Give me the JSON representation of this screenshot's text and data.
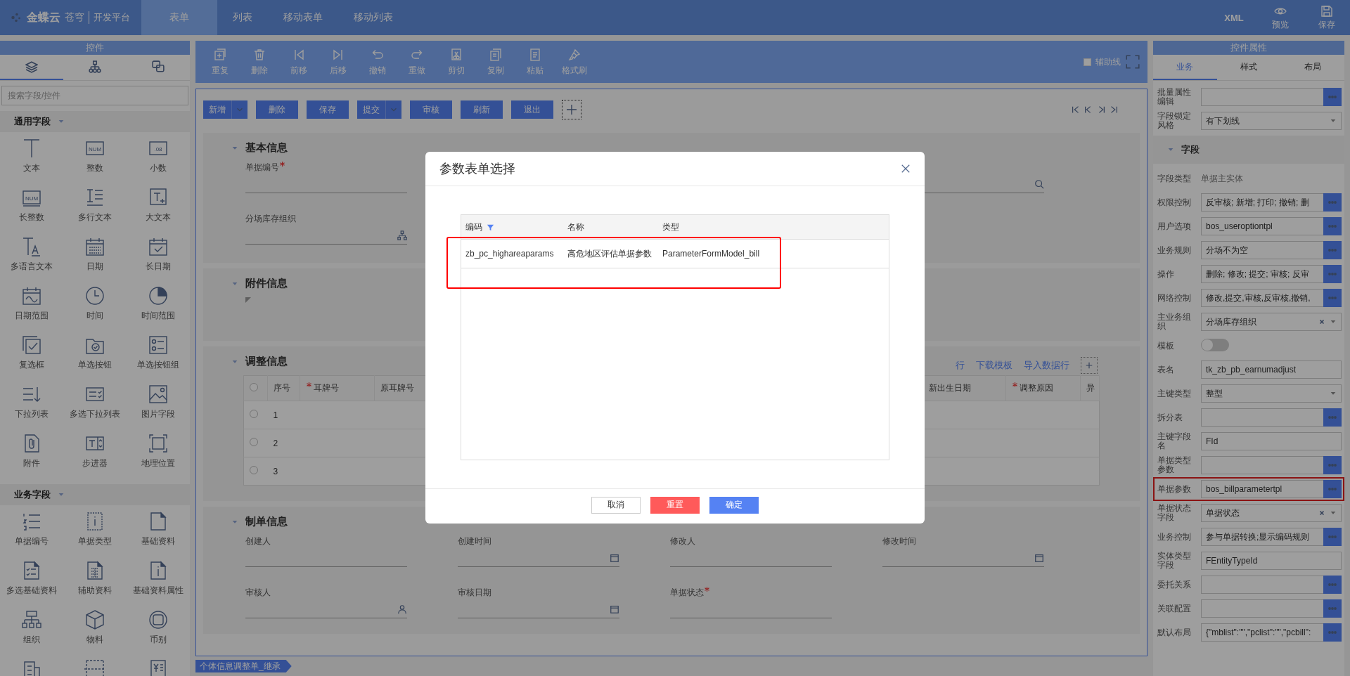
{
  "top_bar": {
    "logo": "金蝶云",
    "logo_sub": "苍穹",
    "platform": "开发平台",
    "tabs": [
      {
        "label": "表单",
        "selected": true
      },
      {
        "label": "列表",
        "selected": false
      },
      {
        "label": "移动表单",
        "selected": false
      },
      {
        "label": "移动列表",
        "selected": false
      }
    ],
    "actions": [
      {
        "label": "XML",
        "kind": "text"
      },
      {
        "label": "预览",
        "kind": "preview"
      },
      {
        "label": "保存",
        "kind": "save"
      }
    ]
  },
  "controls_panel": {
    "title": "控件",
    "tabs": [
      {
        "selected": true
      },
      {
        "selected": false
      },
      {
        "selected": false
      }
    ],
    "search": {
      "placeholder": "搜索字段/控件"
    },
    "groups": [
      {
        "title": "通用字段",
        "expanded": true,
        "icon_texts": [
          "NUM",
          ".08",
          "NUM"
        ],
        "items": [
          {
            "label": "文本"
          },
          {
            "label": "整数"
          },
          {
            "label": "小数"
          },
          {
            "label": "长整数"
          },
          {
            "label": "多行文本"
          },
          {
            "label": "大文本"
          },
          {
            "label": "多语言文本"
          },
          {
            "label": "日期"
          },
          {
            "label": "长日期"
          },
          {
            "label": "日期范围"
          },
          {
            "label": "时间"
          },
          {
            "label": "时间范围"
          },
          {
            "label": "复选框"
          },
          {
            "label": "单选按钮"
          },
          {
            "label": "单选按钮组"
          },
          {
            "label": "下拉列表"
          },
          {
            "label": "多选下拉列表"
          },
          {
            "label": "图片字段"
          },
          {
            "label": "附件"
          },
          {
            "label": "步进器"
          },
          {
            "label": "地理位置"
          }
        ]
      },
      {
        "title": "业务字段",
        "expanded": true,
        "items": [
          {
            "label": "单据编号"
          },
          {
            "label": "单据类型"
          },
          {
            "label": "基础资料"
          },
          {
            "label": "多选基础资料"
          },
          {
            "label": "辅助资料"
          },
          {
            "label": "基础资料属性"
          },
          {
            "label": "组织"
          },
          {
            "label": "物料"
          },
          {
            "label": "币别"
          },
          {
            "kind": "icon_only"
          },
          {
            "kind": "icon_only"
          },
          {
            "kind": "icon_only"
          }
        ]
      }
    ]
  },
  "toolbar": {
    "buttons": [
      {
        "label": "重复"
      },
      {
        "label": "删除"
      },
      {
        "label": "前移"
      },
      {
        "label": "后移"
      },
      {
        "label": "撤销"
      },
      {
        "label": "重做"
      },
      {
        "label": "剪切"
      },
      {
        "label": "复制"
      },
      {
        "label": "粘贴"
      },
      {
        "label": "格式刷"
      }
    ],
    "guide": {
      "label": "辅助线",
      "checked": false
    }
  },
  "form": {
    "buttons": [
      {
        "label": "新增",
        "kind": "split"
      },
      {
        "label": "删除",
        "kind": "plain"
      },
      {
        "label": "保存",
        "kind": "plain"
      },
      {
        "label": "提交",
        "kind": "split"
      },
      {
        "label": "审核",
        "kind": "plain"
      },
      {
        "label": "刷新",
        "kind": "plain"
      },
      {
        "label": "退出",
        "kind": "plain"
      },
      {
        "kind": "add"
      }
    ],
    "sections": [
      {
        "kind": "fields",
        "title": "基本信息",
        "expanded": true,
        "fields": [
          {
            "label": "单据编号",
            "required": true
          },
          {
            "required": false
          },
          {
            "label": "分场库存组织",
            "required": false
          }
        ]
      },
      {
        "kind": "attachments",
        "title": "附件信息",
        "expanded": true
      },
      {
        "kind": "grid",
        "title": "调整信息",
        "expanded": true,
        "all_selected": false,
        "links": [
          "行",
          "下载模板",
          "导入数据行"
        ],
        "columns": [
          {
            "label": "序号",
            "required": false
          },
          {
            "label": "耳牌号",
            "required": true
          },
          {
            "label": "原耳牌号",
            "required": false
          },
          {
            "label": "新出生日期",
            "required": false
          },
          {
            "label": "调整原因",
            "required": true
          },
          {
            "label": "异",
            "required": false
          }
        ],
        "rows": [
          {
            "index": "1",
            "selected": false
          },
          {
            "index": "2",
            "selected": false
          },
          {
            "index": "3",
            "selected": false
          }
        ]
      },
      {
        "kind": "fields",
        "title": "制单信息",
        "expanded": true,
        "fields": [
          {
            "label": "创建人",
            "required": false
          },
          {
            "label": "创建时间",
            "required": false
          },
          {
            "label": "修改人",
            "required": false
          },
          {
            "label": "修改时间",
            "required": false
          },
          {
            "label": "审核人",
            "required": false
          },
          {
            "label": "审核日期",
            "required": false
          },
          {
            "label": "单据状态",
            "required": true
          }
        ]
      }
    ]
  },
  "bottom_tab": "个体信息调整单_继承",
  "properties_panel": {
    "title": "控件属性",
    "tabs": [
      {
        "label": "业务",
        "selected": true
      },
      {
        "label": "样式",
        "selected": false
      },
      {
        "label": "布局",
        "selected": false
      }
    ],
    "rows": [
      {
        "kind": "ellipsis",
        "label": "批量属性编辑"
      },
      {
        "kind": "select",
        "label": "字段锁定风格",
        "value": "有下划线"
      },
      {
        "kind": "section",
        "label": "字段",
        "expanded": true
      },
      {
        "kind": "readonly",
        "label": "字段类型",
        "value": "单据主实体"
      },
      {
        "kind": "ellipsis",
        "label": "权限控制",
        "value": "反审核; 新增; 打印; 撤销; 删"
      },
      {
        "kind": "ellipsis",
        "label": "用户选项",
        "value": "bos_useroptiontpl"
      },
      {
        "kind": "ellipsis",
        "label": "业务规则",
        "value": "分场不为空"
      },
      {
        "kind": "ellipsis",
        "label": "操作",
        "value": "删除; 修改; 提交; 审核; 反审"
      },
      {
        "kind": "ellipsis",
        "label": "网络控制",
        "value": "修改,提交,审核,反审核,撤销,"
      },
      {
        "kind": "select_clear",
        "label": "主业务组织",
        "value": "分场库存组织"
      },
      {
        "kind": "toggle",
        "label": "模板",
        "on": false
      },
      {
        "kind": "text",
        "label": "表名",
        "value": "tk_zb_pb_earnumadjust"
      },
      {
        "kind": "select",
        "label": "主键类型",
        "value": "整型"
      },
      {
        "kind": "ellipsis",
        "label": "拆分表"
      },
      {
        "kind": "text",
        "label": "主键字段名",
        "value": "FId"
      },
      {
        "kind": "ellipsis",
        "label": "单据类型参数"
      },
      {
        "kind": "ellipsis",
        "label": "单据参数",
        "value": "bos_billparametertpl",
        "highlighted": true
      },
      {
        "kind": "select_clear",
        "label": "单据状态字段",
        "value": "单据状态"
      },
      {
        "kind": "ellipsis",
        "label": "业务控制",
        "value": "参与单据转换;显示编码规则"
      },
      {
        "kind": "text",
        "label": "实体类型字段",
        "value": "FEntityTypeId"
      },
      {
        "kind": "ellipsis",
        "label": "委托关系"
      },
      {
        "kind": "ellipsis",
        "label": "关联配置"
      },
      {
        "kind": "ellipsis",
        "label": "默认布局",
        "value": "{\"mblist\":\"\",\"pclist\":\"\",\"pcbill\":"
      }
    ]
  },
  "dialog": {
    "title": "参数表单选择",
    "columns": [
      {
        "label": "编码",
        "filtered": true
      },
      {
        "label": "名称",
        "filtered": false
      },
      {
        "label": "类型",
        "filtered": false
      }
    ],
    "rows": [
      {
        "cells": [
          "zb_pc_highareaparams",
          "高危地区评估单据参数",
          "ParameterFormModel_bill"
        ],
        "highlighted": true
      }
    ],
    "buttons": [
      {
        "label": "取消",
        "kind": "default"
      },
      {
        "label": "重置",
        "kind": "danger"
      },
      {
        "label": "确定",
        "kind": "primary"
      }
    ]
  }
}
